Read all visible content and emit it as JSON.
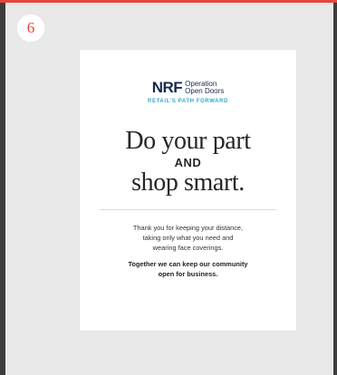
{
  "step": {
    "number": "6"
  },
  "poster": {
    "logo": {
      "mark": "NRF",
      "tagline_line1": "Operation",
      "tagline_line2": "Open Doors",
      "subline": "RETAIL'S PATH FORWARD"
    },
    "headline": {
      "line1": "Do your part",
      "line2": "AND",
      "line3": "shop smart."
    },
    "body_lines": [
      "Thank you for keeping your distance,",
      "taking only what you need and",
      "wearing face coverings."
    ],
    "cta_lines": [
      "Together we can keep our community",
      "open for business."
    ]
  },
  "colors": {
    "accent": "#e8453c",
    "brand_navy": "#16294d",
    "brand_teal": "#32a9c7",
    "background": "#e9e9e9"
  }
}
